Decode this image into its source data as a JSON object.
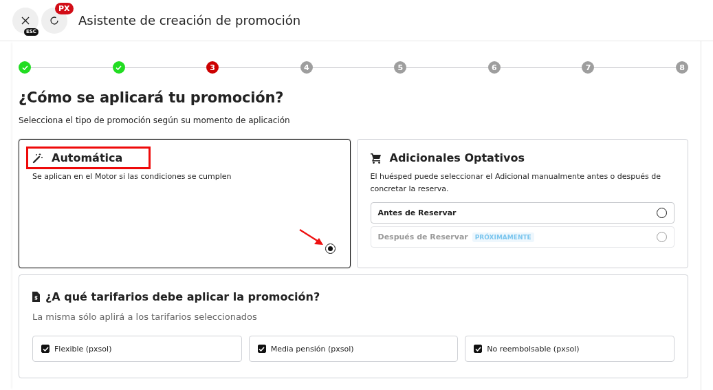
{
  "header": {
    "close_badge": "ESC",
    "app_badge": "PX",
    "title": "Asistente de creación de promoción"
  },
  "steps": [
    {
      "done": true
    },
    {
      "done": true
    },
    {
      "label": "3",
      "done": false,
      "current": true
    },
    {
      "label": "4",
      "done": false,
      "current": false
    },
    {
      "label": "5",
      "done": false,
      "current": false
    },
    {
      "label": "6",
      "done": false,
      "current": false
    },
    {
      "label": "7",
      "done": false,
      "current": false
    },
    {
      "label": "8",
      "done": false,
      "current": false
    }
  ],
  "heading": "¿Cómo se aplicará tu promoción?",
  "subheading": "Selecciona el tipo de promoción según su momento de aplicación",
  "types": [
    {
      "kind": "automatic",
      "title": "Automática",
      "description": "Se aplican en el Motor si las condiciones se cumplen",
      "selected": true,
      "highlighted": true
    },
    {
      "kind": "optional",
      "title": "Adicionales Optativos",
      "description": "El huésped puede seleccionar el Adicional manualmente antes o después de concretar la reserva.",
      "selected": false,
      "highlighted": false,
      "options": [
        {
          "label": "Antes de Reservar",
          "selected": false,
          "disabled": false
        },
        {
          "label": "Después de Reservar",
          "badge": "PRÓXIMAMENTE",
          "selected": false,
          "disabled": true
        }
      ]
    }
  ],
  "rates": {
    "title": "¿A qué tarifarios debe aplicar la promoción?",
    "description": "La misma sólo aplirá a los tarifarios seleccionados",
    "items": [
      {
        "label": "Flexible (pxsol)",
        "checked": true
      },
      {
        "label": "Media pensión (pxsol)",
        "checked": true
      },
      {
        "label": "No reembolsable (pxsol)",
        "checked": true
      }
    ]
  }
}
